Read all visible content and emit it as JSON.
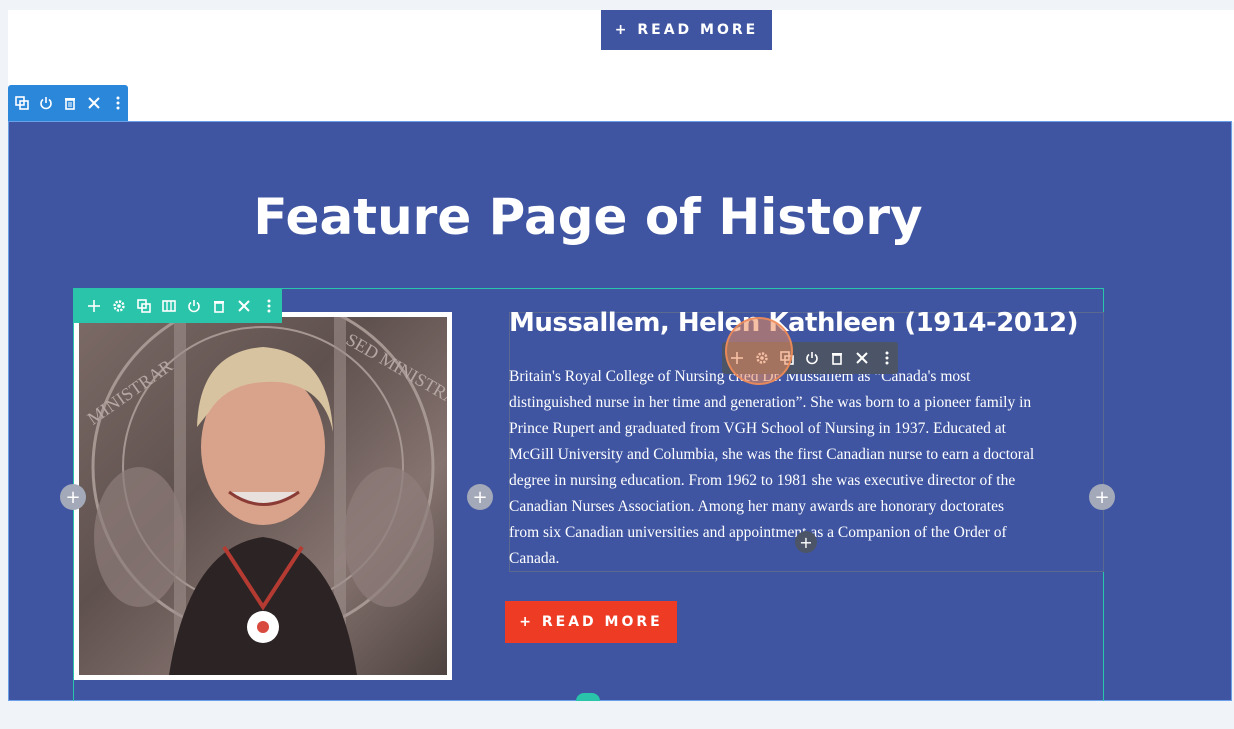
{
  "header_button": {
    "label": "+ READ MORE"
  },
  "section": {
    "title": "Feature Page of History",
    "background_color": "#3f55a2"
  },
  "toolbars": {
    "section": [
      "duplicate-icon",
      "power-icon",
      "trash-icon",
      "close-icon",
      "more-icon"
    ],
    "row": [
      "move-icon",
      "gear-icon",
      "duplicate-icon",
      "columns-icon",
      "power-icon",
      "trash-icon",
      "close-icon",
      "more-icon"
    ],
    "module": [
      "move-icon",
      "gear-icon",
      "duplicate-icon",
      "power-icon",
      "trash-icon",
      "close-icon",
      "more-icon"
    ],
    "section_color": "#2b87da",
    "row_color": "#29c4a9",
    "module_color": "#4b5567"
  },
  "feature": {
    "name": "Mussallem, Helen Kathleen (1914-2012)",
    "bio_lines": [
      "Britain's Royal College of Nursing cited Dr. Mussallem as “Canada's most",
      "distinguished nurse in her time and generation”.  She was born to a pioneer family in",
      "Prince Rupert and graduated from VGH School of Nursing in 1937. Educated at",
      "McGill University and Columbia, she was the first Canadian nurse to earn a doctoral",
      "degree in nursing education.  From 1962 to 1981 she was executive director of the",
      "Canadian Nurses Association.  Among her many awards are honorary doctorates",
      "from six Canadian universities and appointment as a Companion of the Order of",
      "Canada."
    ],
    "button_label": "+ READ MORE",
    "button_color": "#ee3b24",
    "photo_text": [
      "MINISTRAR",
      "SED MINISTRA"
    ]
  },
  "add_buttons": {
    "symbol": "+"
  }
}
